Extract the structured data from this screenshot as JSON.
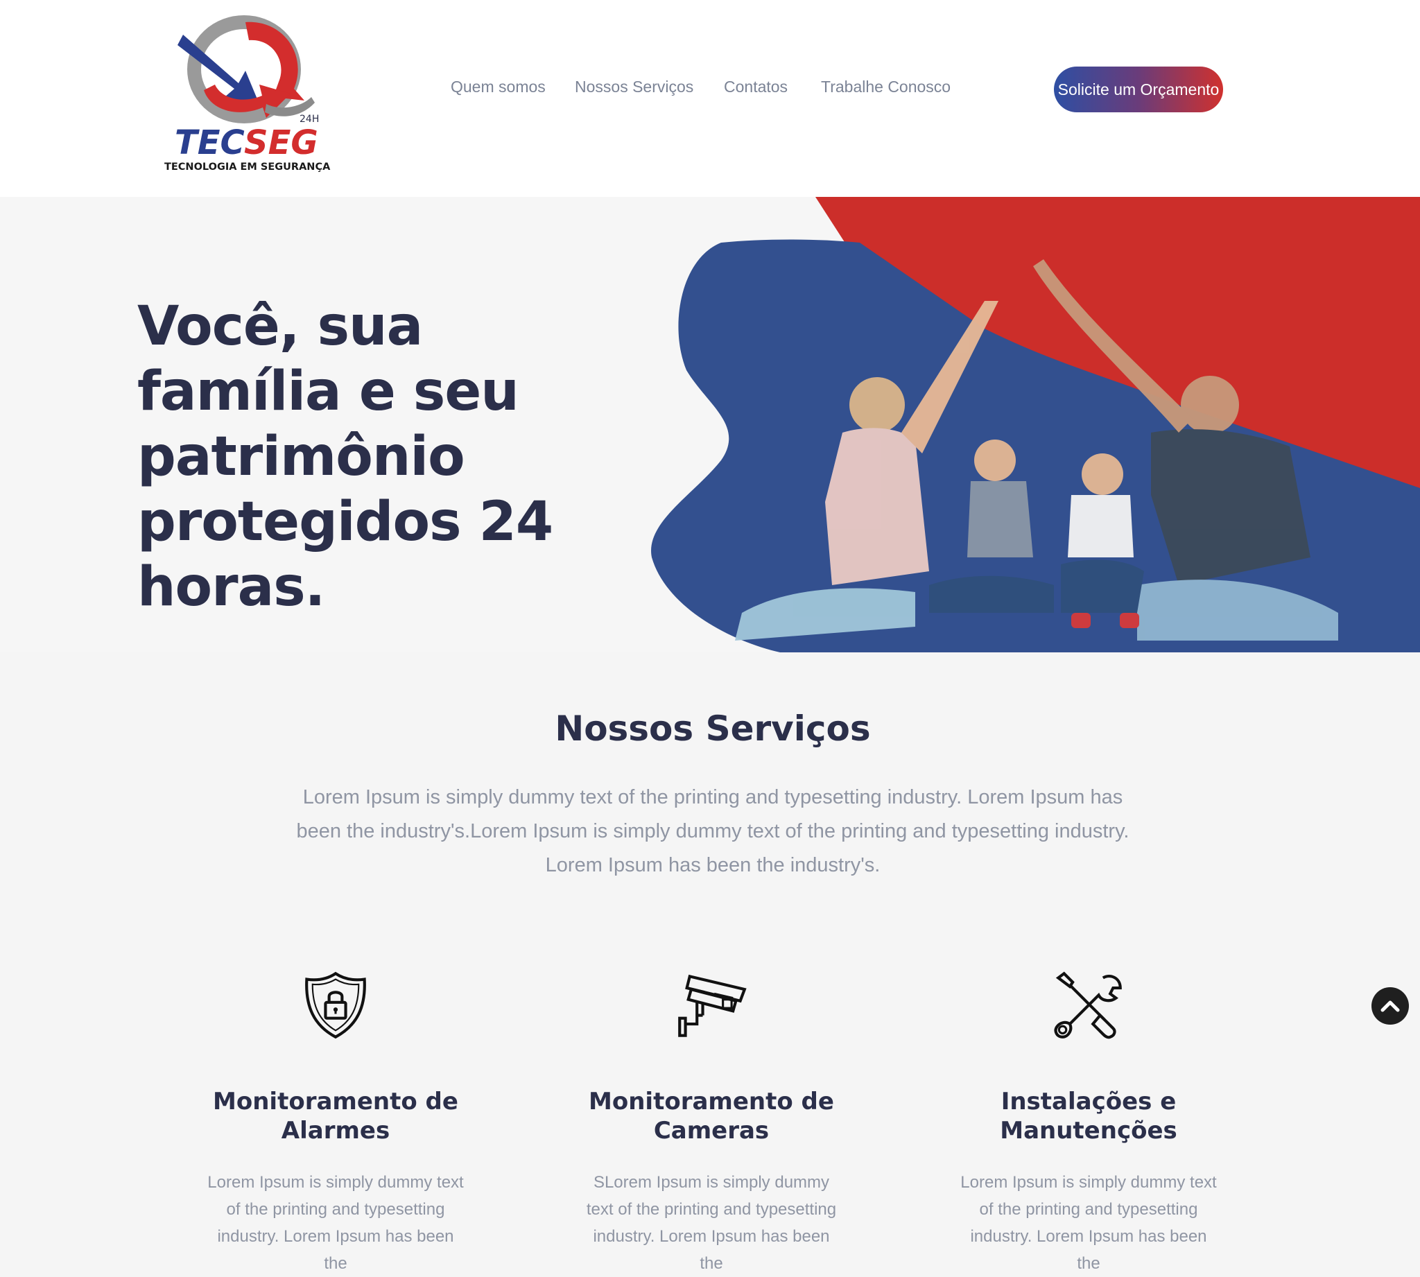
{
  "brand": {
    "name": "TECSEG",
    "name_part1": "TEC",
    "name_part2": "SEG",
    "badge": "24H",
    "tagline": "TECNOLOGIA EM SEGURANÇA"
  },
  "nav": {
    "items": [
      "Quem somos",
      "Nossos Serviços",
      "Contatos",
      "Trabalhe Conosco"
    ],
    "cta": "Solicite um Orçamento"
  },
  "hero": {
    "title": "Você, sua família e seu patrimônio protegidos 24 horas."
  },
  "services": {
    "title": "Nossos Serviços",
    "description": "Lorem Ipsum is simply dummy text of the printing and typesetting industry. Lorem Ipsum has been the industry's.Lorem Ipsum is simply dummy text of the printing and typesetting industry. Lorem Ipsum has been the industry's.",
    "cards": [
      {
        "icon": "shield-lock-icon",
        "title": "Monitoramento de Alarmes",
        "text": "Lorem Ipsum is simply dummy text of the printing and typesetting industry. Lorem Ipsum has been the"
      },
      {
        "icon": "security-camera-icon",
        "title": "Monitoramento de Cameras",
        "text": "SLorem Ipsum is simply dummy text of the printing and typesetting industry. Lorem Ipsum has been the"
      },
      {
        "icon": "tools-icon",
        "title": "Instalações e Manutenções",
        "text": "Lorem Ipsum is simply dummy text of the printing and typesetting industry. Lorem Ipsum has been the"
      }
    ]
  },
  "colors": {
    "brand_blue": "#33508f",
    "brand_red": "#cc2e2a",
    "heading": "#2b2f4a",
    "muted_text": "#8f95a3",
    "nav_text": "#7b8395"
  }
}
